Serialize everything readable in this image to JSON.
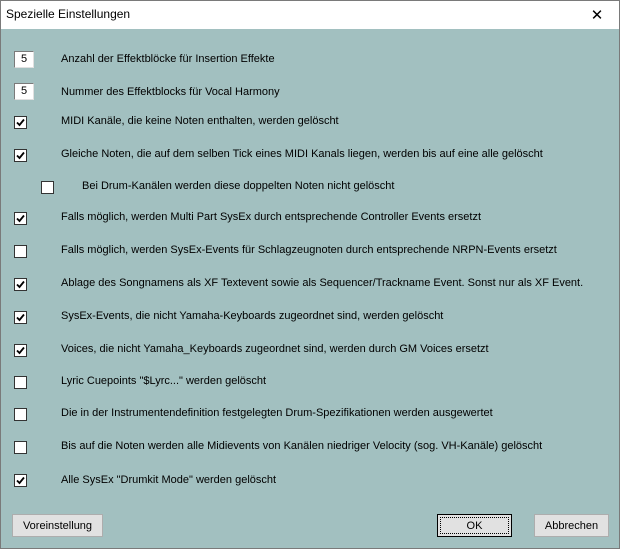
{
  "window": {
    "title": "Spezielle Einstellungen",
    "close_glyph": "✕"
  },
  "fields": {
    "insertion_blocks": {
      "value": "5",
      "label": "Anzahl der Effektblöcke für Insertion Effekte"
    },
    "vocal_harmony_block": {
      "value": "5",
      "label": "Nummer des Effektblocks für Vocal Harmony"
    }
  },
  "options": [
    {
      "checked": true,
      "label": "MIDI Kanäle, die keine Noten enthalten, werden gelöscht"
    },
    {
      "checked": true,
      "label": "Gleiche Noten, die auf dem selben Tick eines MIDI Kanals liegen, werden bis auf eine alle gelöscht"
    },
    {
      "checked": false,
      "label": "Bei Drum-Kanälen werden diese doppelten Noten nicht gelöscht"
    },
    {
      "checked": true,
      "label": "Falls möglich, werden Multi Part SysEx durch entsprechende Controller Events ersetzt"
    },
    {
      "checked": false,
      "label": "Falls möglich, werden SysEx-Events für Schlagzeugnoten durch entsprechende NRPN-Events ersetzt"
    },
    {
      "checked": true,
      "label": "Ablage des Songnamens als XF Textevent sowie als  Sequencer/Trackname Event. Sonst nur als XF Event."
    },
    {
      "checked": true,
      "label": "SysEx-Events, die nicht Yamaha-Keyboards zugeordnet sind, werden gelöscht"
    },
    {
      "checked": true,
      "label": "Voices, die nicht Yamaha_Keyboards zugeordnet sind, werden durch GM Voices ersetzt"
    },
    {
      "checked": false,
      "label": "Lyric Cuepoints \"$Lyrc...\" werden gelöscht"
    },
    {
      "checked": false,
      "label": "Die in der Instrumentendefinition festgelegten Drum-Spezifikationen werden ausgewertet"
    },
    {
      "checked": false,
      "label": "Bis auf die Noten werden alle Midievents von Kanälen niedriger Velocity (sog. VH-Kanäle) gelöscht"
    },
    {
      "checked": true,
      "label": "Alle SysEx \"Drumkit Mode\" werden gelöscht"
    }
  ],
  "buttons": {
    "defaults": "Voreinstellung",
    "ok": "OK",
    "cancel": "Abbrechen"
  },
  "colors": {
    "dialog_background": "#a2c0c0",
    "titlebar": "#ffffff"
  }
}
